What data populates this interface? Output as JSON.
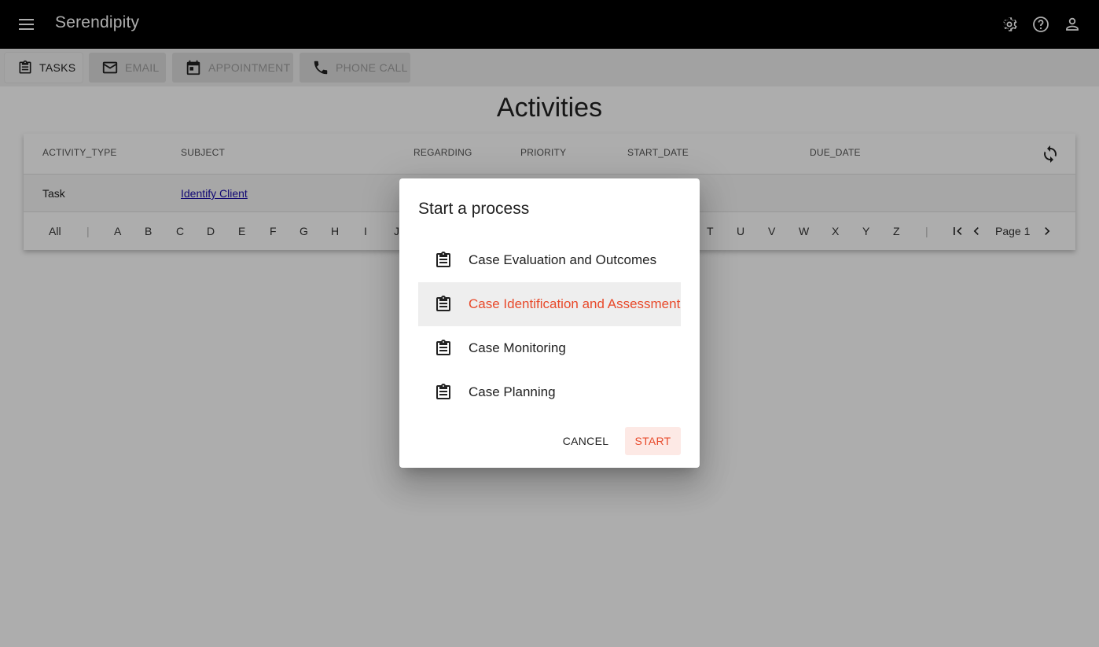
{
  "app": {
    "title": "Serendipity"
  },
  "toolbar": {
    "tasks": "TASKS",
    "email": "EMAIL",
    "appointment": "APPOINTMENT",
    "phone_call": "PHONE CALL"
  },
  "page": {
    "heading": "Activities"
  },
  "grid": {
    "columns": [
      "ACTIVITY_TYPE",
      "SUBJECT",
      "REGARDING",
      "PRIORITY",
      "START_DATE",
      "DUE_DATE"
    ],
    "rows": [
      {
        "activity_type": "Task",
        "subject": "Identify Client"
      }
    ]
  },
  "alphabet": {
    "all": "All",
    "sep": "|",
    "letters": [
      "A",
      "B",
      "C",
      "D",
      "E",
      "F",
      "G",
      "H",
      "I",
      "J",
      "T",
      "U",
      "V",
      "W",
      "X",
      "Y",
      "Z"
    ]
  },
  "pager": {
    "label": "Page 1"
  },
  "dialog": {
    "title": "Start a process",
    "options": [
      "Case Evaluation and Outcomes",
      "Case Identification and Assessment",
      "Case Monitoring",
      "Case Planning"
    ],
    "selected_index": 1,
    "cancel": "CANCEL",
    "start": "START"
  },
  "colors": {
    "accent": "#e84a2b",
    "appbar": "#000000"
  }
}
